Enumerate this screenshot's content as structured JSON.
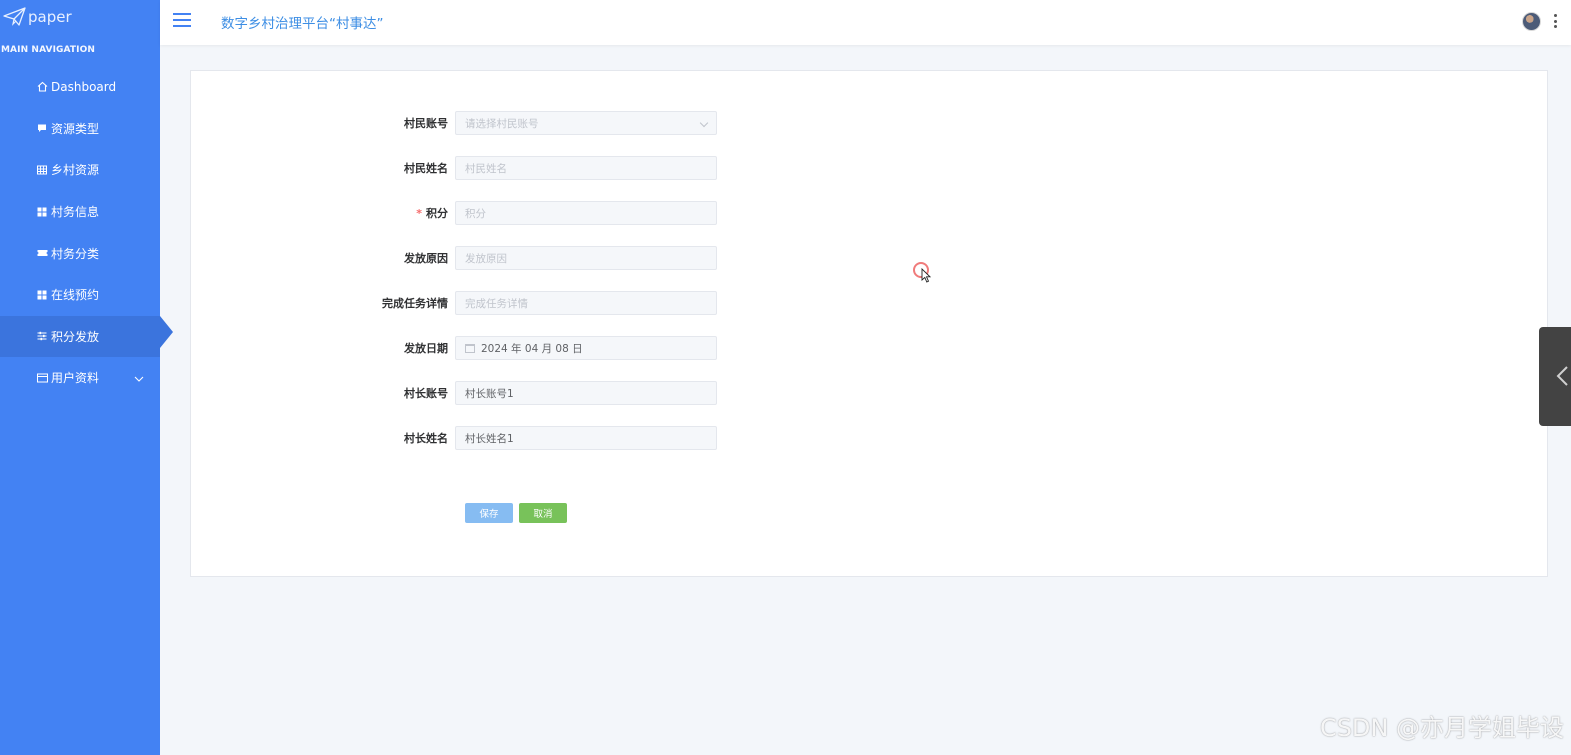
{
  "sidebar": {
    "logo_text": "paper",
    "heading": "MAIN NAVIGATION",
    "items": [
      {
        "label": "Dashboard",
        "icon": "home-icon"
      },
      {
        "label": "资源类型",
        "icon": "comment-icon"
      },
      {
        "label": "乡村资源",
        "icon": "table-icon"
      },
      {
        "label": "村务信息",
        "icon": "grid-icon"
      },
      {
        "label": "村务分类",
        "icon": "ticket-icon"
      },
      {
        "label": "在线预约",
        "icon": "grid-icon"
      },
      {
        "label": "积分发放",
        "icon": "sliders-icon",
        "active": true
      },
      {
        "label": "用户资料",
        "icon": "card-icon",
        "has_submenu": true
      }
    ]
  },
  "header": {
    "title": "数字乡村治理平台“村事达”"
  },
  "form": {
    "fields": [
      {
        "label": "村民账号",
        "placeholder": "请选择村民账号",
        "value": "",
        "type": "select"
      },
      {
        "label": "村民姓名",
        "placeholder": "村民姓名",
        "value": ""
      },
      {
        "label": "积分",
        "placeholder": "积分",
        "value": "",
        "required": true
      },
      {
        "label": "发放原因",
        "placeholder": "发放原因",
        "value": ""
      },
      {
        "label": "完成任务详情",
        "placeholder": "完成任务详情",
        "value": ""
      },
      {
        "label": "发放日期",
        "placeholder": "",
        "value": "2024 年 04 月 08 日",
        "type": "date"
      },
      {
        "label": "村长账号",
        "placeholder": "",
        "value": "村长账号1"
      },
      {
        "label": "村长姓名",
        "placeholder": "",
        "value": "村长姓名1"
      }
    ],
    "save_label": "保存",
    "cancel_label": "取消"
  },
  "watermark": "CSDN @亦月学姐毕设",
  "colors": {
    "sidebar_bg": "#4382f3",
    "active_bg": "#3b74dd",
    "title": "#3d8ee4",
    "save_btn": "#86bcf2",
    "cancel_btn": "#78c25a",
    "required": "#f56c6c"
  }
}
